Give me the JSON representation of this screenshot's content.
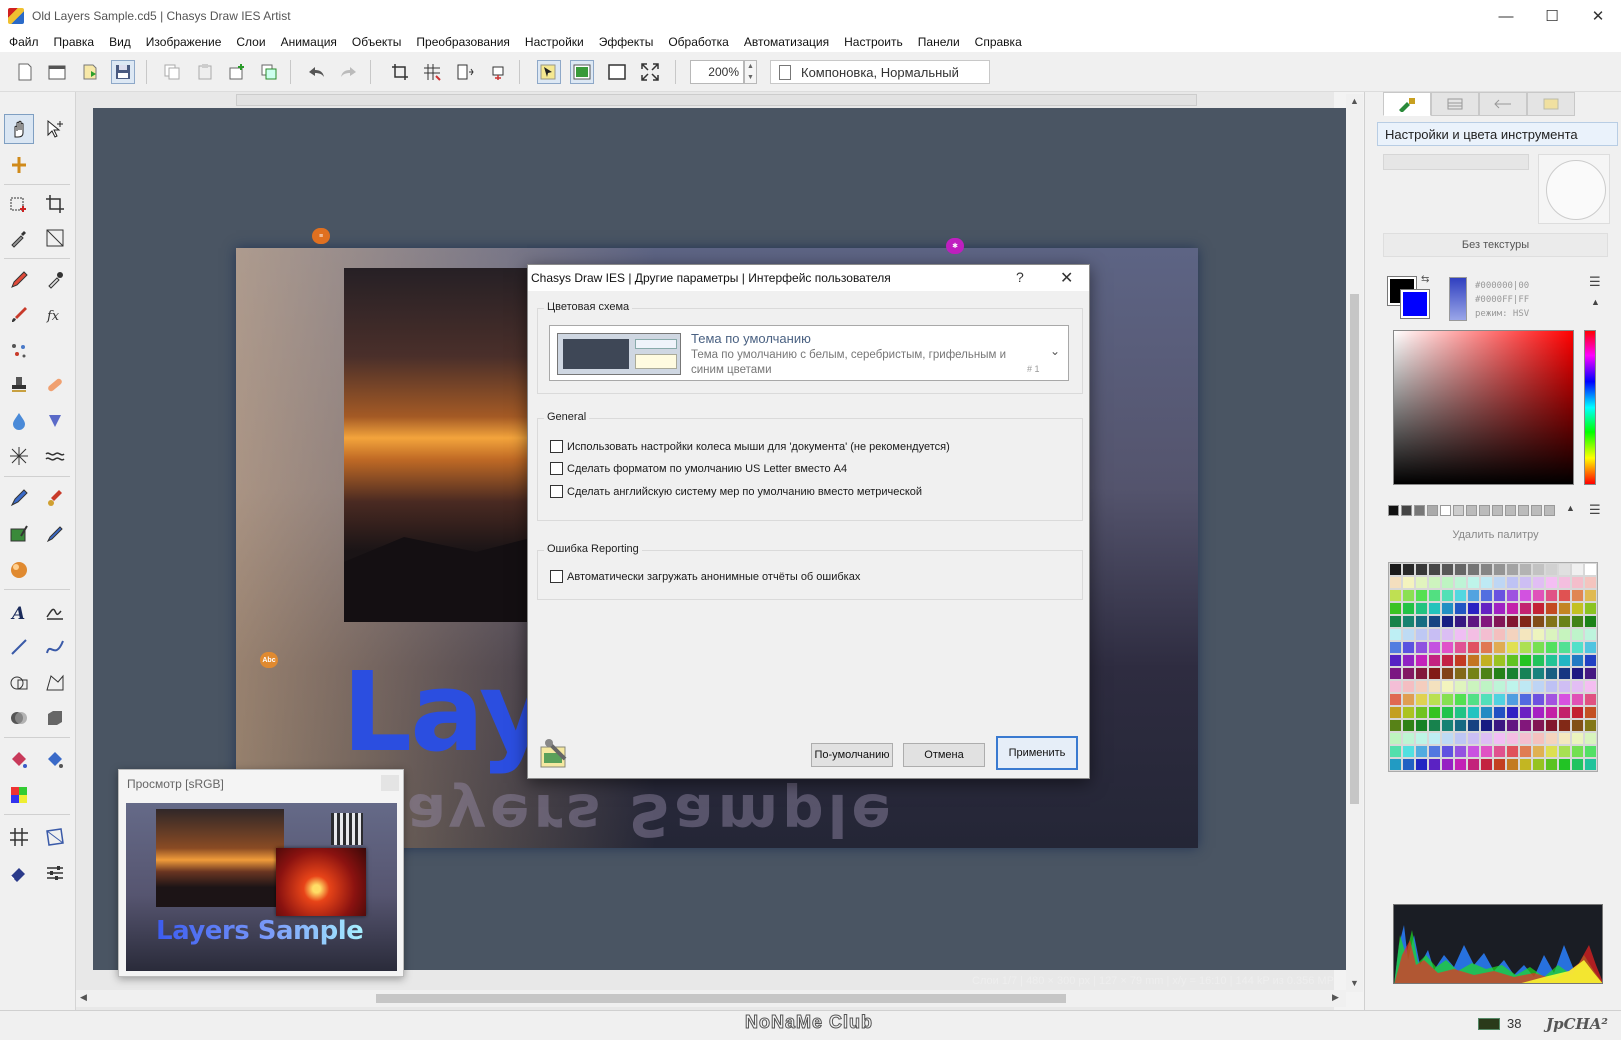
{
  "window": {
    "title": "Old Layers Sample.cd5 | Chasys Draw IES Artist",
    "minimize": "—",
    "maximize": "☐",
    "close": "✕"
  },
  "menu": [
    "Файл",
    "Правка",
    "Вид",
    "Изображение",
    "Слои",
    "Анимация",
    "Объекты",
    "Преобразования",
    "Настройки",
    "Эффекты",
    "Обработка",
    "Автоматизация",
    "Настроить",
    "Панели",
    "Справка"
  ],
  "toolbar": {
    "zoom_value": "200%",
    "compose_mode": "Компоновка, Нормальный",
    "icons": [
      "new-file-icon",
      "open-icon",
      "import-icon",
      "save-icon",
      "copy-icon",
      "paste-icon",
      "new-layer-icon",
      "duplicate-layer-icon",
      "undo-icon",
      "redo-icon",
      "crop-icon",
      "grid-icon",
      "resize-icon",
      "transform-icon",
      "select-tool-icon",
      "image-icon",
      "frame-icon",
      "fullscreen-icon"
    ]
  },
  "tools": [
    "hand-icon",
    "move-pointer-icon",
    "anchor-icon",
    "selection-add-icon",
    "crop-icon",
    "eyedropper-icon",
    "transform-icon",
    "pencil-icon",
    "color-picker-icon",
    "brush-icon",
    "fx-icon",
    "scatter-icon",
    "stamp-icon",
    "bandage-icon",
    "drop-icon",
    "smudge-icon",
    "splatter-icon",
    "wave-icon",
    "marker-icon",
    "paint-bucket-icon",
    "image-edit-icon",
    "pen-icon",
    "sphere-icon",
    "text-icon",
    "signature-icon",
    "line-icon",
    "curve-icon",
    "shape-icon",
    "polygon-icon",
    "blend-icon",
    "box-icon",
    "fill-icon",
    "gradient-fill-icon",
    "palette-icon",
    "grid-tool-icon",
    "warp-icon",
    "eraser-icon",
    "sliders-icon"
  ],
  "canvas": {
    "document_text": "Layers",
    "reflection_text": "Layers Sample",
    "status": "Слои 1/7 | 480 × 300 px | 127 × 79 mm | x/y = 16:10 | 144 kP из 0.356 MP",
    "marker_text": "Abc"
  },
  "preview": {
    "title": "Просмотр [sRGB]",
    "caption": "Layers Sample"
  },
  "dialog": {
    "title": "Chasys Draw IES | Другие параметры | Интерфейс пользователя",
    "help": "?",
    "close": "✕",
    "color_scheme_label": "Цветовая схема",
    "scheme_name": "Тема по умолчанию",
    "scheme_desc": "Тема по умолчанию с белым, серебристым, грифельным и синим цветами",
    "scheme_num": "# 1",
    "general_label": "General",
    "options": [
      "Использовать настройки колеса мыши для 'документа' (не рекомендуется)",
      "Сделать форматом по умолчанию US Letter вместо A4",
      "Сделать английскую систему мер по умолчанию вместо метрической"
    ],
    "error_label": "Ошибка Reporting",
    "error_option": "Автоматически загружать анонимные отчёты об ошибках",
    "btn_default": "По-умолчанию",
    "btn_cancel": "Отмена",
    "btn_apply": "Применить"
  },
  "right_panel": {
    "header": "Настройки и цвета инструмента",
    "texture": "Без текстуры",
    "color_info": "#000000|00\n#0000FF|FF\nрежим: HSV",
    "delete_palette": "Удалить палитру",
    "fg_color": "#000000",
    "bg_color": "#0000FF"
  },
  "bottom": {
    "watermark": "NoNaMe Club",
    "cpu": "38",
    "brand": "JpCHA²"
  }
}
